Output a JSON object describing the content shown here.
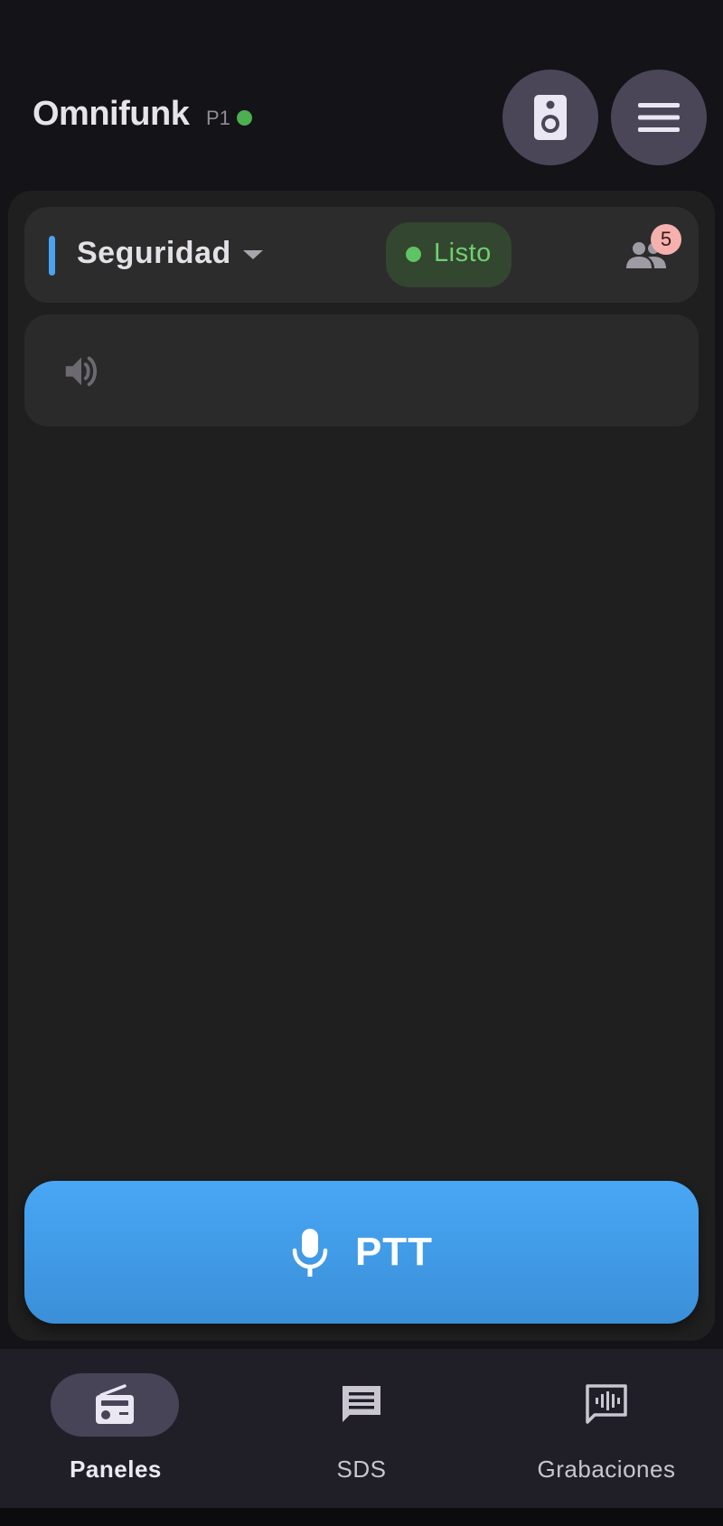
{
  "header": {
    "title": "Omnifunk",
    "profile": "P1",
    "connection_status_color": "#4caf50",
    "speaker_icon": "speaker-icon",
    "menu_icon": "menu-icon"
  },
  "channel": {
    "name": "Seguridad",
    "accent_color": "#4aa3f0",
    "status": "Listo",
    "status_color": "#6fd071",
    "members_icon": "group-icon",
    "member_count": "5"
  },
  "audio": {
    "icon": "volume-up-icon"
  },
  "ptt": {
    "label": "PTT",
    "icon": "microphone-icon",
    "color": "#48a7f5"
  },
  "nav": {
    "items": [
      {
        "label": "Paneles",
        "icon": "radio-icon",
        "active": true
      },
      {
        "label": "SDS",
        "icon": "message-icon",
        "active": false
      },
      {
        "label": "Grabaciones",
        "icon": "voice-recording-icon",
        "active": false
      }
    ]
  }
}
